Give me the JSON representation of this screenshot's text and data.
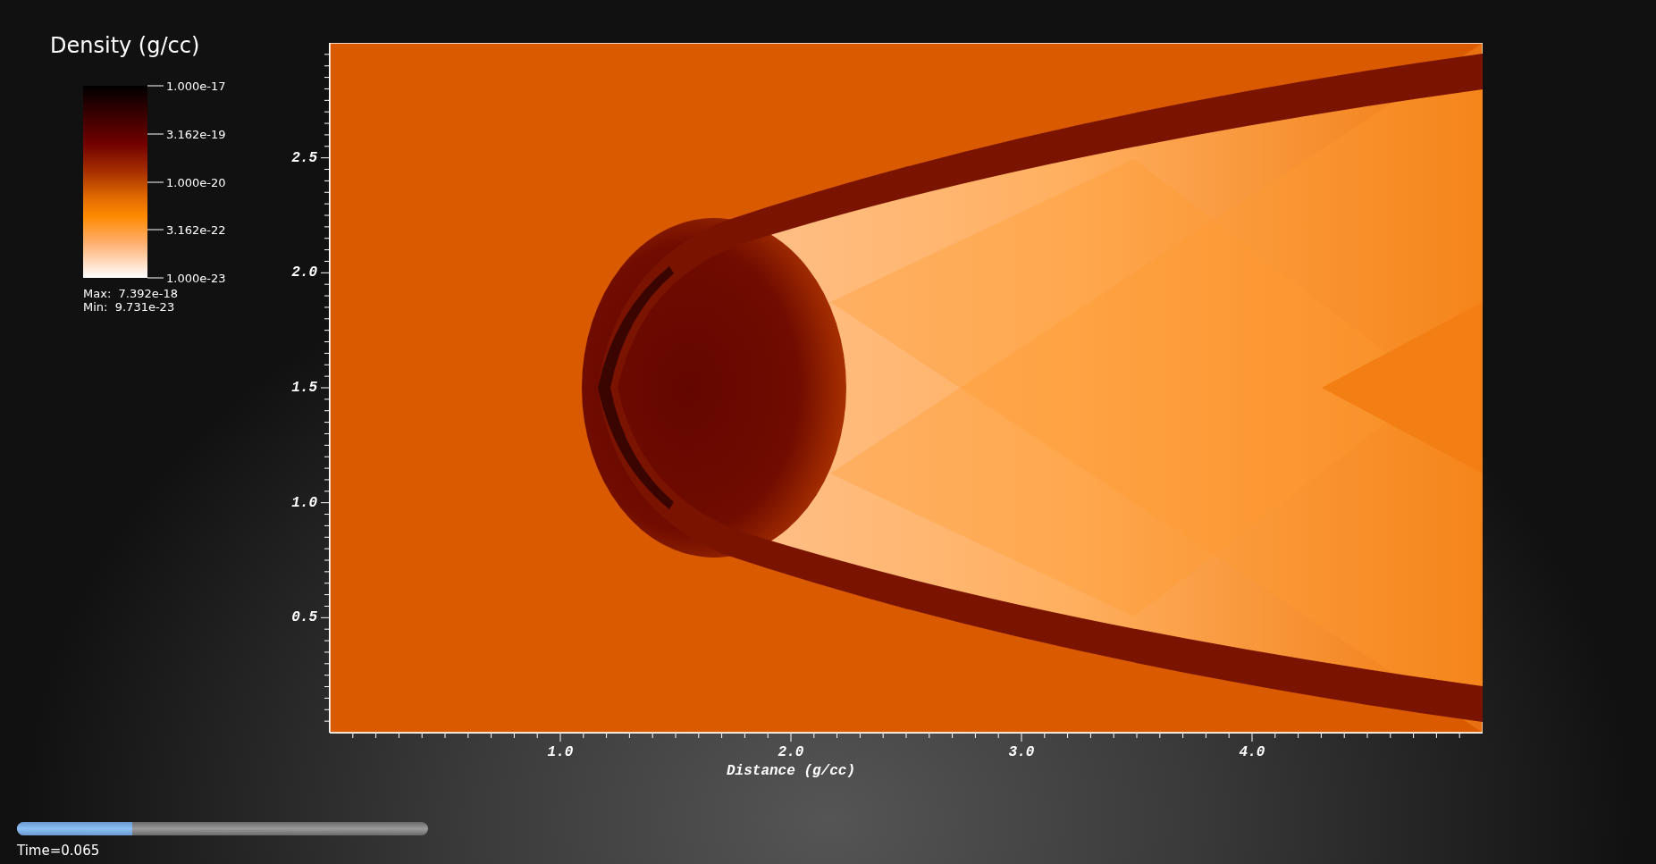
{
  "legend": {
    "title": "Density (g/cc)",
    "ticks": [
      "1.000e-17",
      "3.162e-19",
      "1.000e-20",
      "3.162e-22",
      "1.000e-23"
    ],
    "max": "Max:  7.392e-18",
    "min": "Min:  9.731e-23"
  },
  "plot": {
    "y_ticks": [
      "2.5",
      "2.0",
      "1.5",
      "1.0",
      "0.5"
    ],
    "x_ticks": [
      "1.0",
      "2.0",
      "3.0",
      "4.0"
    ],
    "x_title": "Distance (g/cc)"
  },
  "time_slider": {
    "level": 0.28,
    "label": "Time=0.065"
  }
}
